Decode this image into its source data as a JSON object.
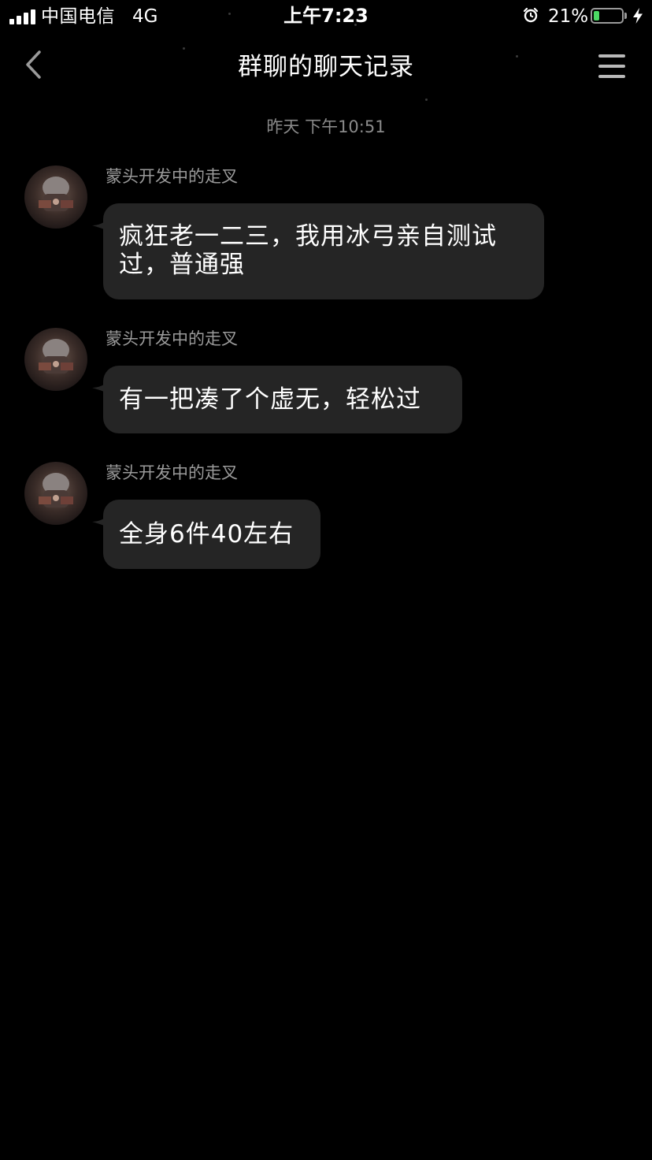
{
  "status_bar": {
    "carrier": "中国电信",
    "network": "4G",
    "time": "上午7:23",
    "battery_percent": "21%",
    "battery_level": 0.21,
    "icons": [
      "signal-icon",
      "alarm-icon",
      "battery-icon",
      "charging-icon"
    ]
  },
  "nav": {
    "title": "群聊的聊天记录",
    "back_icon": "chevron-left-icon",
    "menu_icon": "menu-icon"
  },
  "chat": {
    "timestamp": "昨天 下午10:51",
    "messages": [
      {
        "sender": "蒙头开发中的走叉",
        "text": "疯狂老一二三，我用冰弓亲自测试过，普通强"
      },
      {
        "sender": "蒙头开发中的走叉",
        "text": "有一把凑了个虚无，轻松过"
      },
      {
        "sender": "蒙头开发中的走叉",
        "text": "全身6件40左右"
      }
    ]
  },
  "colors": {
    "background": "#000000",
    "bubble": "#252525",
    "secondary_text": "#9a9a9a",
    "battery_fill": "#4cd964"
  }
}
